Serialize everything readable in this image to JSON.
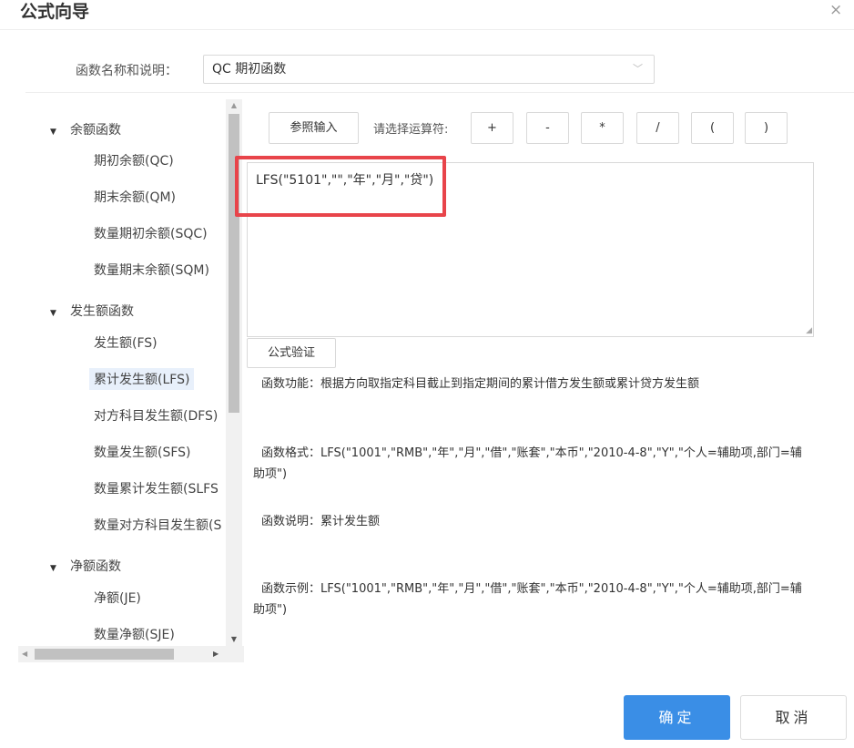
{
  "dialog": {
    "title": "公式向导",
    "close_icon": "×"
  },
  "function_select": {
    "label": "函数名称和说明：",
    "value": "QC 期初函数"
  },
  "tree": {
    "groups": [
      {
        "label": "余额函数",
        "children": [
          "期初余额(QC)",
          "期末余额(QM)",
          "数量期初余额(SQC)",
          "数量期末余额(SQM)"
        ]
      },
      {
        "label": "发生额函数",
        "children": [
          "发生额(FS)",
          "累计发生额(LFS)",
          "对方科目发生额(DFS)",
          "数量发生额(SFS)",
          "数量累计发生额(SLFS",
          "数量对方科目发生额(S"
        ]
      },
      {
        "label": "净额函数",
        "children": [
          "净额(JE)",
          "数量净额(SJE)"
        ]
      }
    ],
    "selected": "累计发生额(LFS)"
  },
  "toolbar": {
    "ref_input": "参照输入",
    "operator_label": "请选择运算符:",
    "operators": [
      "+",
      "-",
      "*",
      "/",
      "(",
      ")"
    ]
  },
  "formula": {
    "value": "LFS(\"5101\",\"\",\"年\",\"月\",\"贷\")"
  },
  "verify_button": "公式验证",
  "description": {
    "function": "函数功能：根据方向取指定科目截止到指定期间的累计借方发生额或累计贷方发生额",
    "format_line1": "函数格式：LFS(\"1001\",\"RMB\",\"年\",\"月\",\"借\",\"账套\",\"本币\",\"2010-4-8\",\"Y\",\"个人=辅助项,部门=辅",
    "format_line2": "助项\")",
    "explain": "函数说明：累计发生额",
    "example_line1": "函数示例：LFS(\"1001\",\"RMB\",\"年\",\"月\",\"借\",\"账套\",\"本币\",\"2010-4-8\",\"Y\",\"个人=辅助项,部门=辅",
    "example_line2": "助项\")"
  },
  "footer": {
    "ok": "确定",
    "cancel": "取消"
  },
  "colors": {
    "primary": "#3a8ee6",
    "highlight": "#e8444a",
    "selected_bg": "#e8f0fb"
  }
}
